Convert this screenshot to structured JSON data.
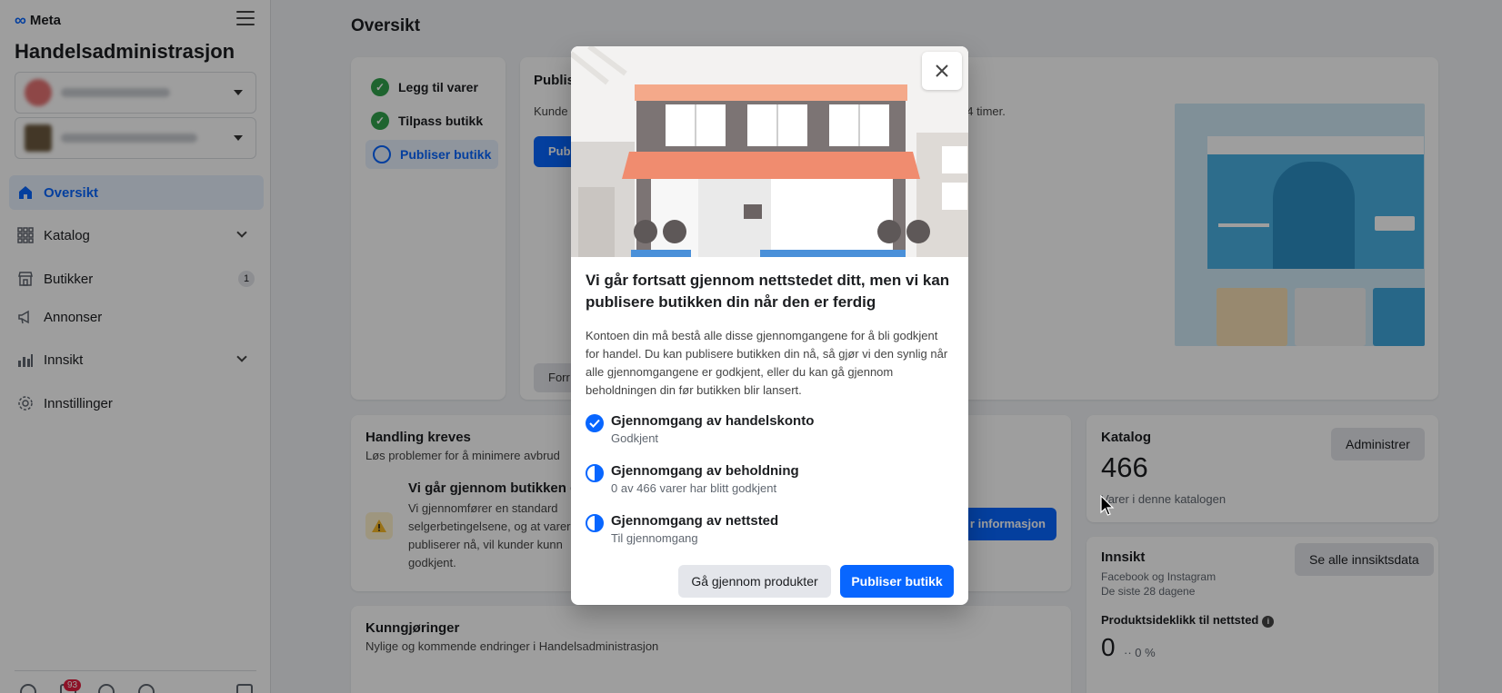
{
  "sidebar": {
    "logo_text": "Meta",
    "app_title": "Handelsadministrasjon",
    "nav": [
      {
        "label": "Oversikt",
        "icon": "home-icon"
      },
      {
        "label": "Katalog",
        "icon": "grid-icon"
      },
      {
        "label": "Butikker",
        "icon": "store-icon",
        "count": "1"
      },
      {
        "label": "Annonser",
        "icon": "megaphone-icon"
      },
      {
        "label": "Innsikt",
        "icon": "bar-chart-icon"
      },
      {
        "label": "Innstillinger",
        "icon": "gear-icon"
      }
    ],
    "notification_count": "93"
  },
  "main": {
    "page_title": "Oversikt",
    "steps": [
      {
        "label": "Legg til varer",
        "done": true
      },
      {
        "label": "Tilpass butikk",
        "done": true
      },
      {
        "label": "Publiser butikk",
        "done": false
      }
    ],
    "publish_card": {
      "title_fragment": "Publis",
      "desc_fragment": "Kunde",
      "desc_tail": "24 timer.",
      "button_fragment": "Pub",
      "secondary_fragment": "Forr"
    },
    "action": {
      "title": "Handling kreves",
      "subtitle": "Løs problemer for å minimere avbrud",
      "review_title": "Vi går gjennom butikken d",
      "review_body": "Vi gjennomfører en standard selgerbetingelsene, og at varer publiserer nå, vil kunder kunn godkjent.",
      "button_fragment": "r informasjon"
    },
    "announcements": {
      "title": "Kunngjøringer",
      "subtitle": "Nylige og kommende endringer i Handelsadministrasjon"
    },
    "catalog": {
      "title": "Katalog",
      "button": "Administrer",
      "count": "466",
      "subtitle": "Varer i denne katalogen"
    },
    "insights": {
      "title": "Innsikt",
      "button": "Se alle innsiktsdata",
      "sub1": "Facebook og Instagram",
      "sub2": "De siste 28 dagene",
      "metric_label": "Produktsideklikk til nettsted",
      "value": "0",
      "change": "0 %"
    }
  },
  "modal": {
    "title": "Vi går fortsatt gjennom nettstedet ditt, men vi kan publisere butikken din når den er ferdig",
    "description": "Kontoen din må bestå alle disse gjennomgangene for å bli godkjent for handel. Du kan publisere butikken din nå, så gjør vi den synlig når alle gjennomgangene er godkjent, eller du kan gå gjennom beholdningen din før butikken blir lansert.",
    "requirements": [
      {
        "title": "Gjennomgang av handelskonto",
        "status": "Godkjent",
        "icon": "check-circle-icon"
      },
      {
        "title": "Gjennomgang av beholdning",
        "status": "0 av 466 varer har blitt godkjent",
        "icon": "half-circle-icon"
      },
      {
        "title": "Gjennomgang av nettsted",
        "status": "Til gjennomgang",
        "icon": "half-circle-icon"
      }
    ],
    "secondary_button": "Gå gjennom produkter",
    "primary_button": "Publiser butikk"
  },
  "colors": {
    "accent": "#0866ff",
    "success": "#31a24c",
    "warning": "#f7b928"
  }
}
